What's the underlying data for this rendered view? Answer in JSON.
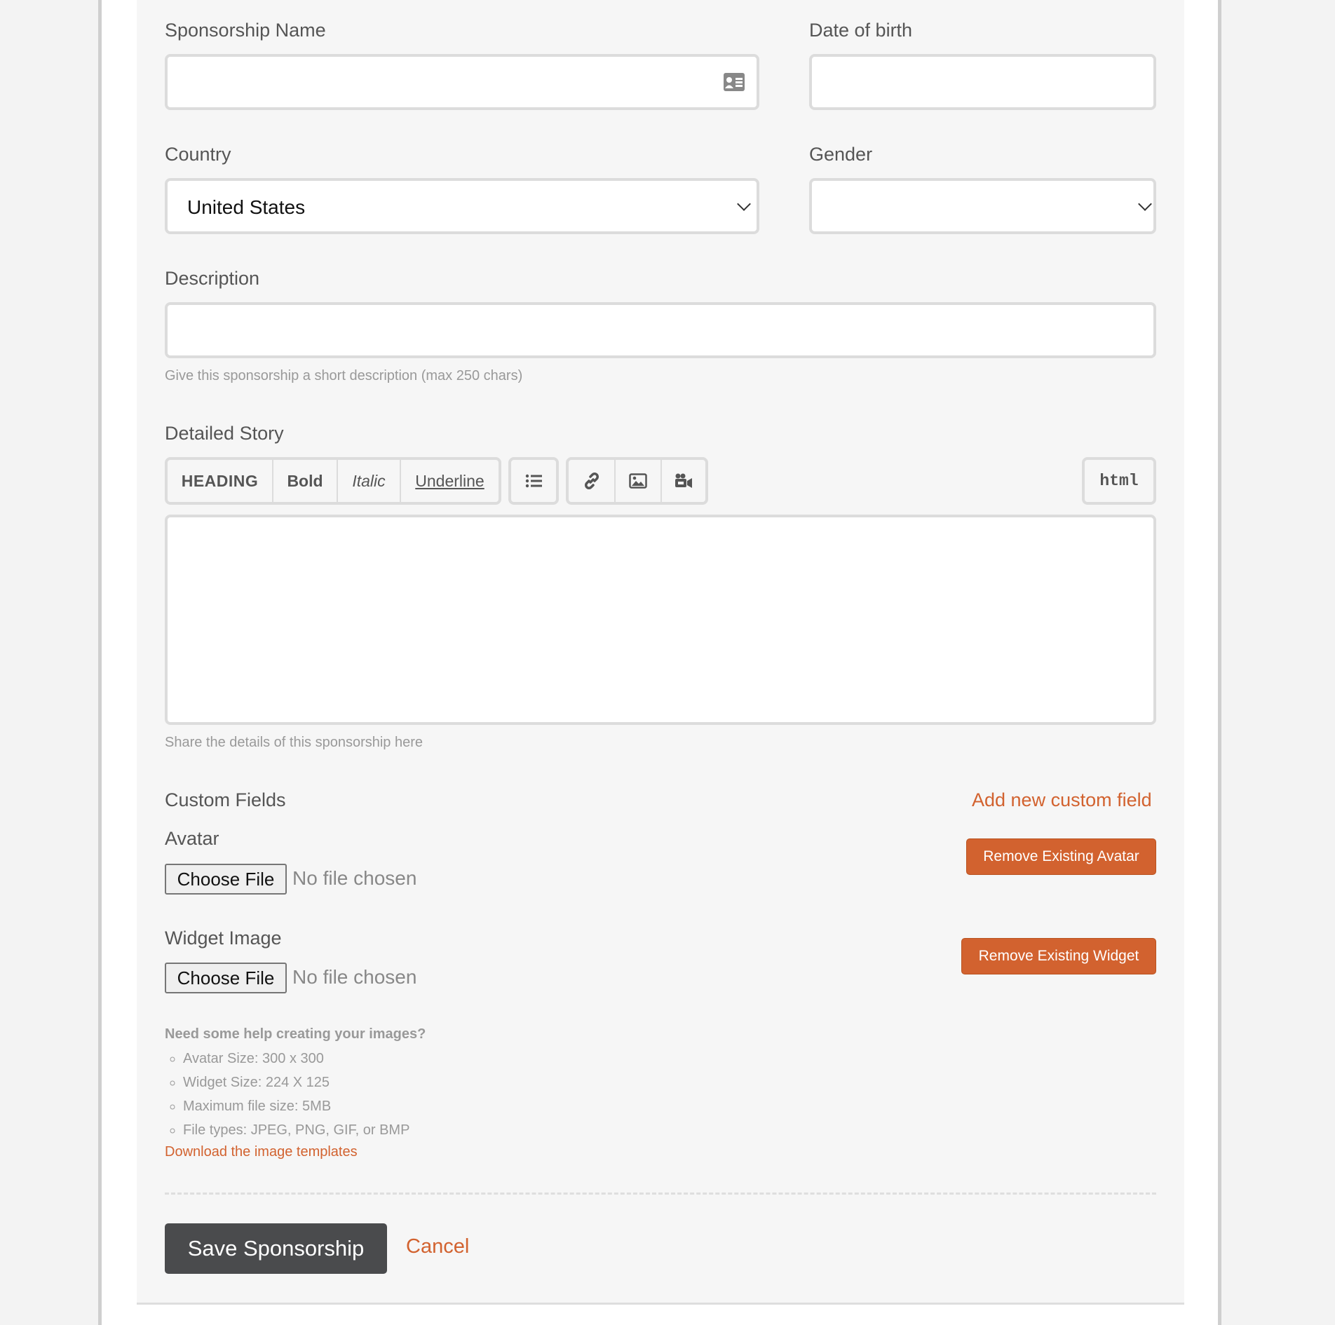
{
  "form": {
    "sponsorship_name_label": "Sponsorship Name",
    "date_of_birth_label": "Date of birth",
    "country_label": "Country",
    "country_value": "United States",
    "gender_label": "Gender",
    "gender_value": "",
    "description_label": "Description",
    "description_help": "Give this sponsorship a short description (max 250 chars)",
    "story_label": "Detailed Story",
    "story_help": "Share the details of this sponsorship here"
  },
  "toolbar": {
    "heading": "HEADING",
    "bold": "Bold",
    "italic": "Italic",
    "underline": "Underline",
    "html": "html",
    "icons": [
      "list-icon",
      "link-icon",
      "image-icon",
      "video-icon"
    ]
  },
  "custom_fields": {
    "title": "Custom Fields",
    "add_link": "Add new custom field",
    "avatar_label": "Avatar",
    "widget_label": "Widget Image",
    "choose_file": "Choose File",
    "no_file": "No file chosen",
    "remove_avatar": "Remove Existing Avatar",
    "remove_widget": "Remove Existing Widget"
  },
  "help": {
    "title": "Need some help creating your images?",
    "items": [
      "Avatar Size: 300 x 300",
      "Widget Size: 224 X 125",
      "Maximum file size: 5MB",
      "File types: JPEG, PNG, GIF, or BMP"
    ],
    "download_link": "Download the image templates"
  },
  "actions": {
    "save": "Save Sponsorship",
    "cancel": "Cancel"
  },
  "colors": {
    "accent": "#d2622f",
    "save_button": "#4a4b4d",
    "panel_bg": "#f6f6f6"
  }
}
